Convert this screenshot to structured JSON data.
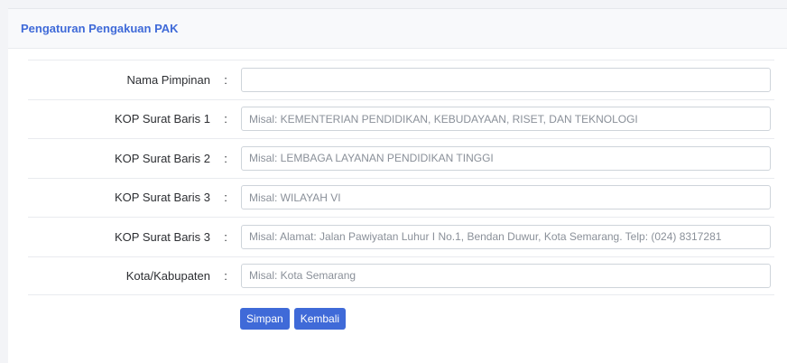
{
  "card": {
    "title": "Pengaturan Pengakuan PAK"
  },
  "form": {
    "separator": ":",
    "fields": [
      {
        "label": "Nama Pimpinan",
        "value": "",
        "placeholder": ""
      },
      {
        "label": "KOP Surat Baris 1",
        "value": "",
        "placeholder": "Misal: KEMENTERIAN PENDIDIKAN, KEBUDAYAAN, RISET, DAN TEKNOLOGI"
      },
      {
        "label": "KOP Surat Baris 2",
        "value": "",
        "placeholder": "Misal: LEMBAGA LAYANAN PENDIDIKAN TINGGI"
      },
      {
        "label": "KOP Surat Baris 3",
        "value": "",
        "placeholder": "Misal: WILAYAH VI"
      },
      {
        "label": "KOP Surat Baris 3",
        "value": "",
        "placeholder": "Misal: Alamat: Jalan Pawiyatan Luhur I No.1, Bendan Duwur, Kota Semarang. Telp: (024) 8317281"
      },
      {
        "label": "Kota/Kabupaten",
        "value": "",
        "placeholder": "Misal: Kota Semarang"
      }
    ]
  },
  "actions": {
    "save_label": "Simpan",
    "back_label": "Kembali"
  },
  "colors": {
    "accent": "#3f6ad8",
    "background": "#f3f4f7"
  }
}
